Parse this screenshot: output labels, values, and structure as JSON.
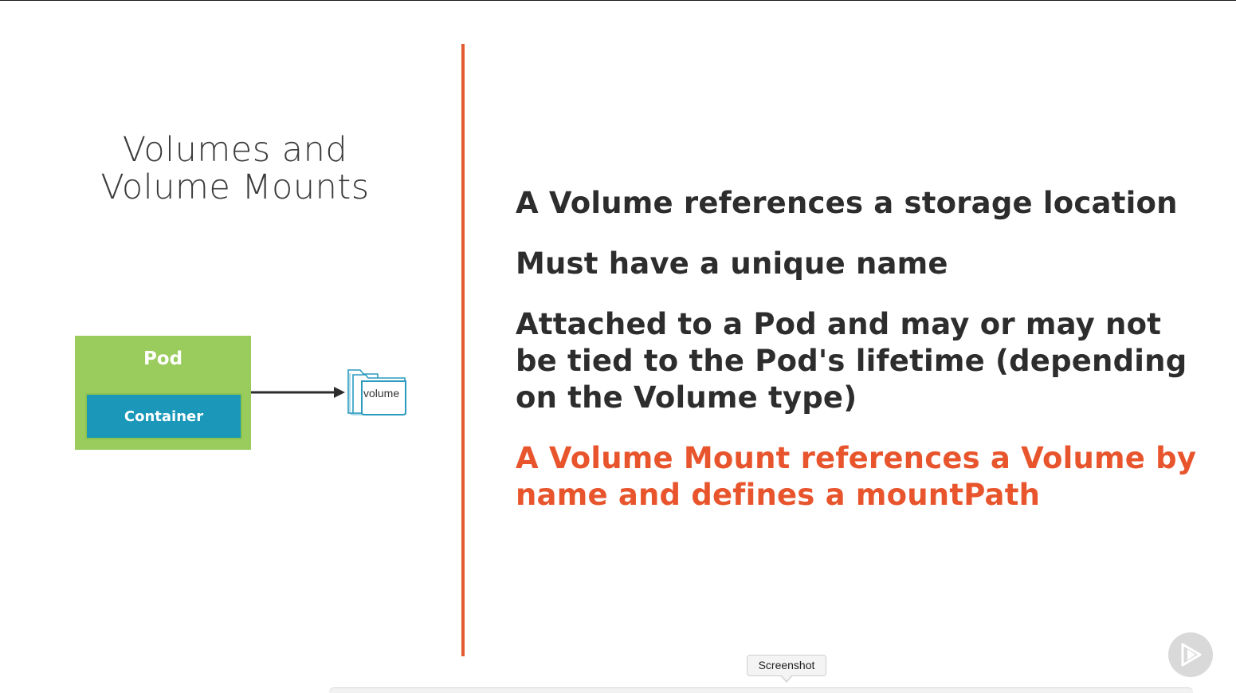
{
  "slide": {
    "title_line1": "Volumes and",
    "title_line2": "Volume Mounts",
    "accent_color": "#e35b32"
  },
  "diagram": {
    "pod_label": "Pod",
    "container_label": "Container",
    "volume_label": "volume",
    "pod_color": "#99cc5c",
    "container_color": "#1a97b9",
    "volume_icon": "folder-icon"
  },
  "bullets": [
    {
      "text": "A Volume references a storage location",
      "highlight": false
    },
    {
      "text": "Must have a unique name",
      "highlight": false
    },
    {
      "text": "Attached to a Pod and may or may not be tied to the Pod's lifetime (depending on the Volume type)",
      "highlight": false
    },
    {
      "text": "A Volume Mount references a Volume by name and defines a mountPath",
      "highlight": true
    }
  ],
  "overlay": {
    "tooltip_text": "Screenshot",
    "play_icon": "play-logo-icon"
  }
}
